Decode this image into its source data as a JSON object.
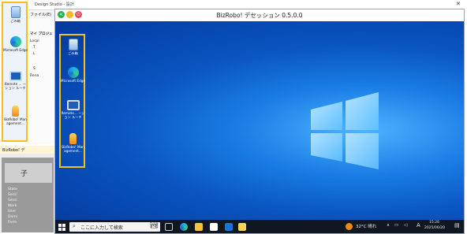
{
  "host": {
    "window_title": "Design Studio - 設計",
    "menu_label": "ファイル(E)",
    "tree_header": "マイ プロジェ",
    "tree_items": [
      "Local",
      "T",
      "L",
      "",
      "S",
      "Rena"
    ],
    "desktop_icons": [
      {
        "label": "ごみ箱",
        "icon": "recycle-bin-icon"
      },
      {
        "label": "Microsoft Edge",
        "icon": "edge-icon"
      },
      {
        "label": "Remote ... ーション ルーチ",
        "icon": "remote-desktop-icon"
      },
      {
        "label": "BizRobo! Management...",
        "icon": "bizrobo-icon"
      }
    ],
    "biz_panel_title": "BizRobo! デ",
    "biz_panel_heading": "子",
    "biz_panel_lines": [
      "State",
      "Sessi",
      "Sessi",
      "Work",
      "User",
      "Domi",
      "Farm"
    ]
  },
  "session": {
    "title": "BizRobo! デセッション 0.5.0.0",
    "controls": {
      "back": "<",
      "minimize": "-",
      "close": "⏻"
    },
    "desktop_icons": [
      {
        "label": "ごみ箱",
        "icon": "recycle-bin-icon"
      },
      {
        "label": "Microsoft Edge",
        "icon": "edge-icon"
      },
      {
        "label": "Remote... ーション ルーチ",
        "icon": "remote-desktop-icon"
      },
      {
        "label": "BizRobo! Management...",
        "icon": "bizrobo-icon"
      }
    ],
    "taskbar": {
      "search_placeholder": "ここに入力して検索",
      "weather": "32°C 晴れ",
      "ime": "A",
      "time": "15:26",
      "date": "2025/06/20"
    }
  },
  "colors": {
    "highlight_frame": "#f1c21b",
    "desktop_blue": "#0b5fc9",
    "taskbar": "#101720"
  }
}
